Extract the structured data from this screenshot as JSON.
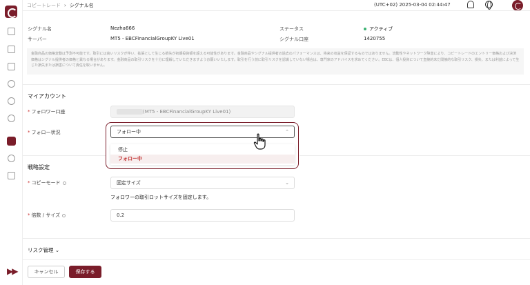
{
  "breadcrumb": {
    "parent": "コピートレード",
    "current": "シグナル名"
  },
  "header": {
    "timezone_time": "(UTC+02)  2025-03-04 02:44:47"
  },
  "info": {
    "signal_name_label": "シグナル名",
    "signal_name_value": "Nezha666",
    "server_label": "サーバー",
    "server_value": "MT5 - EBCFinancialGroupKY Live01",
    "status_label": "ステータス",
    "status_value": "アクティブ",
    "signal_account_label": "シグナル口座",
    "signal_account_value": "1420755"
  },
  "disclaimer": "金融商品の価格変動は予測不可能です。取引には高いリスクが伴い、拡張として生じる損失が初期投資額を超える可能性があります。金融商品やシグナル提供者の過去のパフォーマンスは、将来の収益を保証するものではありません。流動性やネットワーク障害により、コピートレードのエントリー価格および決済価格はシグナル提供者の価格と異なる場合があります。金融商品の取引リスクを十分に理解していただきますようお願いいたします。取引を行う前に取引リスクを認識していない場合は、専門家のアドバイスを求めてください。EBCは、個人投資について直接的未だ間接的な取引リスク、損失、または利益によって生じた損失または損害について責任を取いません。",
  "my_account": {
    "title": "マイアカウント",
    "follower_account_label": "フォロワー口座",
    "follower_account_value": "(MT5 - EBCFinancialGroupKY Live01)",
    "follow_status_label": "フォロー状況",
    "follow_status_value": "フォロー中",
    "options": [
      "停止",
      "フォロー中"
    ]
  },
  "strategy": {
    "title": "戦略設定",
    "copy_mode_label": "コピーモード",
    "copy_mode_value": "固定サイズ",
    "copy_mode_hint": "フォロワーの取引ロットサイズを固定します。",
    "multiplier_label": "倍数 / サイズ",
    "multiplier_value": "0.2"
  },
  "risk": {
    "title": "リスク管理"
  },
  "buttons": {
    "cancel": "キャンセル",
    "save": "保存する"
  },
  "colors": {
    "brand": "#7a1d2a",
    "active_status": "#3bb273",
    "selected_option": "#c03030"
  }
}
